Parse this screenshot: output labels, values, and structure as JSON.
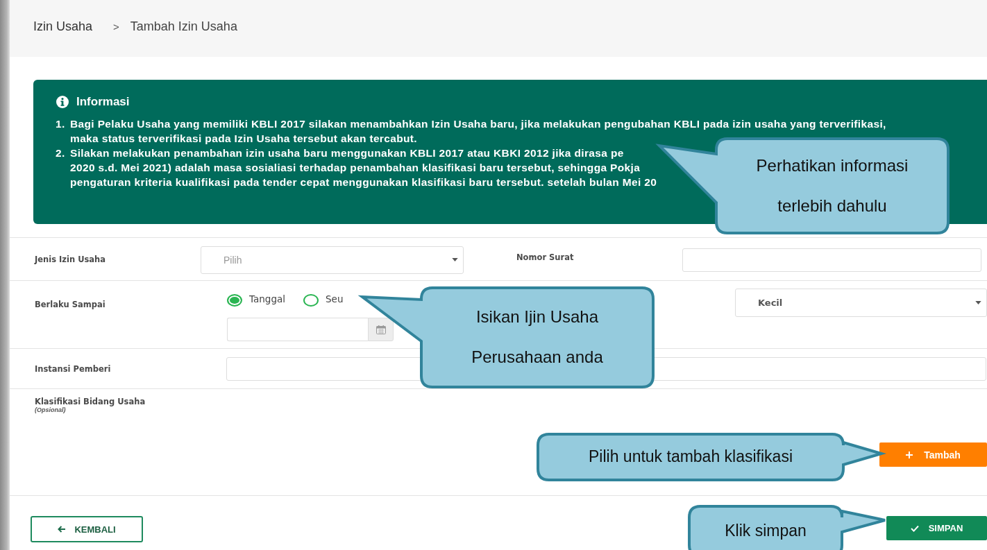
{
  "breadcrumb": {
    "items": [
      "Izin Usaha",
      "Tambah Izin Usaha"
    ],
    "separator": ">"
  },
  "info": {
    "title": "Informasi",
    "items": [
      {
        "number": "1.",
        "lines": [
          "Bagi Pelaku Usaha yang memiliki KBLI 2017 silakan menambahkan Izin Usaha baru, jika melakukan pengubahan KBLI pada izin usaha yang terverifikasi,",
          "maka status terverifikasi pada Izin Usaha tersebut akan tercabut."
        ]
      },
      {
        "number": "2.",
        "lines": [
          "Silakan melakukan penambahan izin usaha baru menggunakan KBLI 2017 atau KBKI 2012 jika dirasa pe",
          "2020 s.d. Mei 2021) adalah masa sosialiasi terhadap penambahan klasifikasi baru tersebut, sehingga Pokja",
          "pengaturan kriteria kualifikasi pada tender cepat menggunakan klasifikasi baru tersebut. setelah bulan Mei 20"
        ]
      }
    ]
  },
  "jenis_izin_usaha": {
    "label": "Jenis Izin Usaha",
    "placeholder": "Pilih"
  },
  "nomor_surat": {
    "label": "Nomor Surat"
  },
  "berlaku_sampai": {
    "label": "Berlaku Sampai",
    "options": [
      {
        "label": "Tanggal",
        "selected": true
      },
      {
        "label": "Seu",
        "selected": false
      }
    ]
  },
  "kualifikasi": {
    "value": "Kecil"
  },
  "instansi_pemberi": {
    "label": "Instansi Pemberi"
  },
  "klasifikasi": {
    "label": "Klasifikasi Bidang Usaha",
    "note": "(Opsional)",
    "button": "Tambah"
  },
  "footer": {
    "back": "KEMBALI",
    "save": "SIMPAN"
  },
  "callouts": [
    {
      "lines": [
        "Perhatikan informasi",
        "terlebih dahulu"
      ]
    },
    {
      "lines": [
        "Isikan Ijin Usaha",
        "Perusahaan anda"
      ]
    },
    {
      "lines": [
        "Pilih untuk tambah klasifikasi"
      ]
    },
    {
      "lines": [
        "Klik simpan"
      ]
    }
  ]
}
